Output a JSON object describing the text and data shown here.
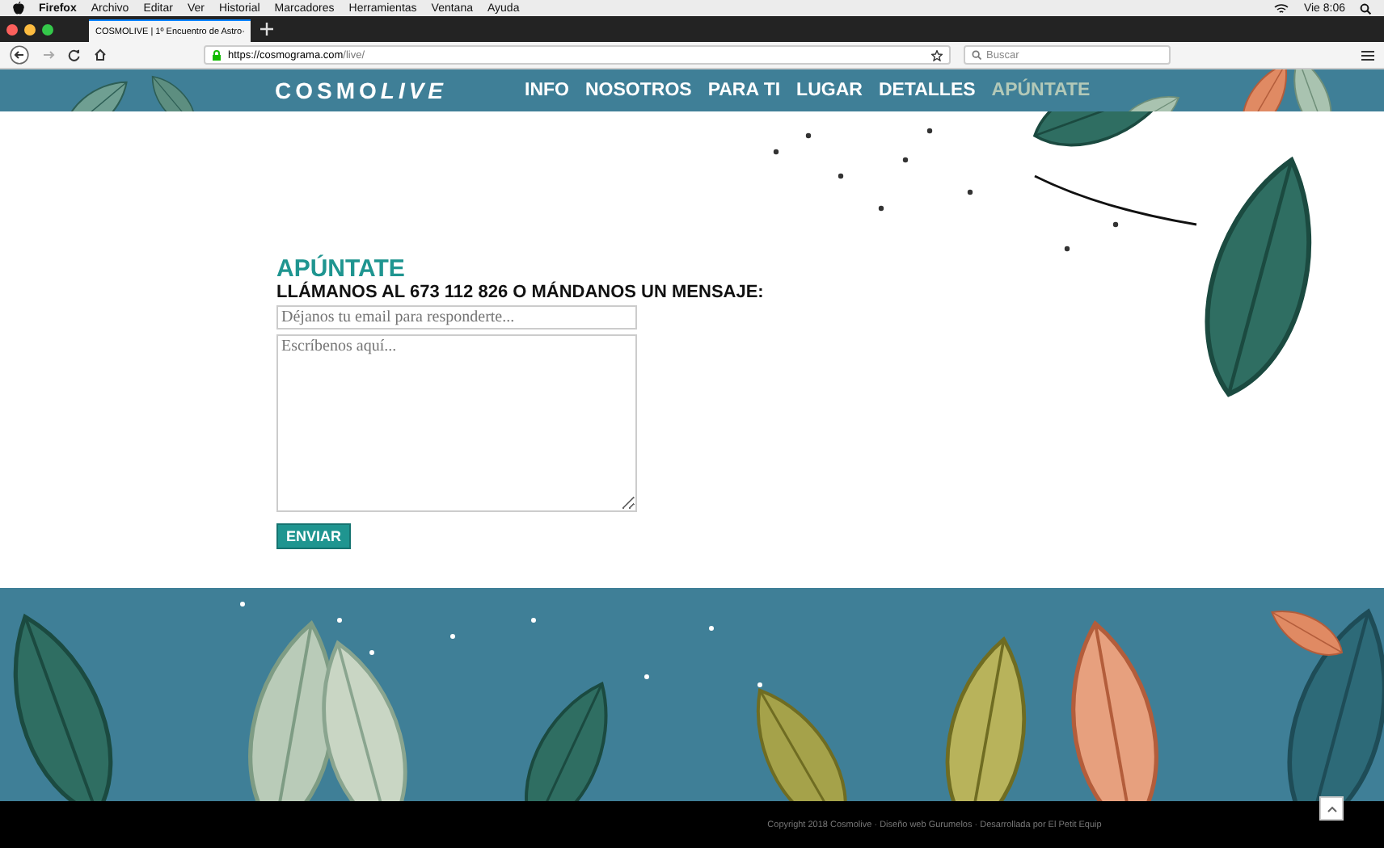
{
  "menubar": {
    "app": "Firefox",
    "items": [
      "Archivo",
      "Editar",
      "Ver",
      "Historial",
      "Marcadores",
      "Herramientas",
      "Ventana",
      "Ayuda"
    ],
    "clock": "Vie 8:06"
  },
  "browser": {
    "tab_title": "COSMOLIVE | 1º Encuentro de Astro",
    "url_host": "https://cosmograma.com",
    "url_path": "/live/",
    "search_placeholder": "Buscar"
  },
  "site": {
    "logo_main": "COSMO",
    "logo_accent": "LIVE",
    "nav": [
      {
        "label": "INFO",
        "selected": false
      },
      {
        "label": "NOSOTROS",
        "selected": false
      },
      {
        "label": "PARA TI",
        "selected": false
      },
      {
        "label": "LUGAR",
        "selected": false
      },
      {
        "label": "DETALLES",
        "selected": false
      },
      {
        "label": "APÚNTATE",
        "selected": true
      }
    ]
  },
  "form": {
    "heading": "APÚNTATE",
    "subheading": "LLÁMANOS AL 673 112 826 O MÁNDANOS UN MENSAJE:",
    "email_placeholder": "Déjanos tu email para responderte...",
    "message_placeholder": "Escríbenos aquí...",
    "submit": "ENVIAR"
  },
  "footer": {
    "copyright": "Copyright 2018 Cosmolive · Diseño web Gurumelos · Desarrollada por El Petit Equip"
  }
}
